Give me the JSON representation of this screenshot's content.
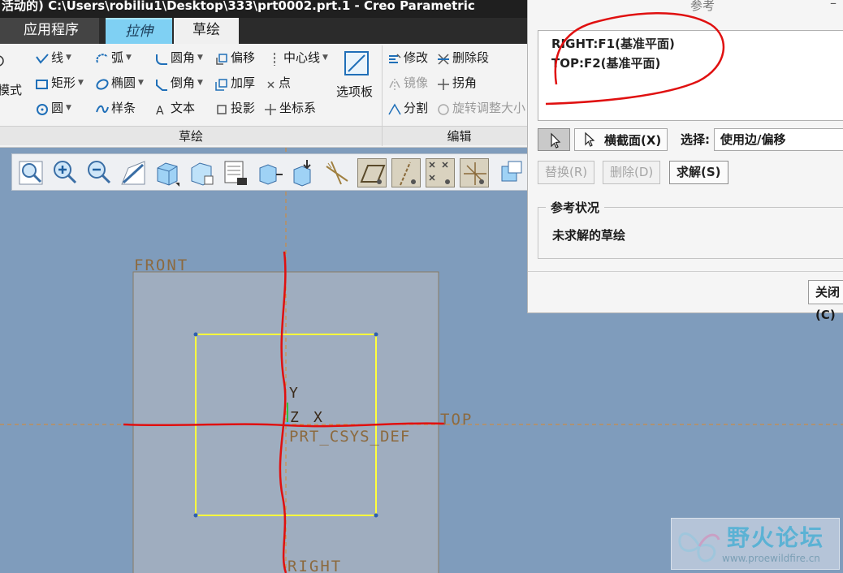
{
  "window": {
    "title": "活动的) C:\\Users\\robiliu1\\Desktop\\333\\prt0002.prt.1 - Creo Parametric"
  },
  "tabs": [
    {
      "label": "应用程序"
    },
    {
      "label": "拉伸"
    },
    {
      "label": "草绘"
    }
  ],
  "ribbon": {
    "mode_label": "模式",
    "sketch_group": {
      "label": "草绘",
      "line": "线",
      "arc": "弧",
      "fillet": "圆角",
      "offset": "偏移",
      "centerline": "中心线",
      "rectangle": "矩形",
      "ellipse": "椭圆",
      "chamfer": "倒角",
      "thicken": "加厚",
      "point": "点",
      "circle": "圆",
      "spline": "样条",
      "text": "文本",
      "project": "投影",
      "csys": "坐标系",
      "palette": "选项板"
    },
    "edit_group": {
      "label": "编辑",
      "modify": "修改",
      "delete_segment": "删除段",
      "mirror": "镜像",
      "corner": "拐角",
      "divide": "分割",
      "rotate_resize": "旋转调整大小"
    }
  },
  "canvas": {
    "front_label": "FRONT",
    "top_label": "TOP",
    "right_label": "RIGHT",
    "csys_label": "PRT_CSYS_DEF",
    "axis_y": "Y",
    "axis_z": "Z",
    "axis_x": "X",
    "colors": {
      "background": "#7f9cbc",
      "plane": "#9fadbf",
      "sketch": "#ffff3c",
      "annotation": "#e01010"
    }
  },
  "references_dialog": {
    "title": "参考",
    "references": [
      "RIGHT:F1(基准平面)",
      "TOP:F2(基准平面)"
    ],
    "cross_section_button": "横截面(X)",
    "select_label": "选择:",
    "select_value": "使用边/偏移",
    "replace_button": "替换(R)",
    "delete_button": "删除(D)",
    "solve_button": "求解(S)",
    "status_legend": "参考状况",
    "status_text": "未求解的草绘",
    "close_button": "关闭(C)"
  },
  "watermark": {
    "name": "野火论坛",
    "url": "www.proewildfire.cn"
  }
}
